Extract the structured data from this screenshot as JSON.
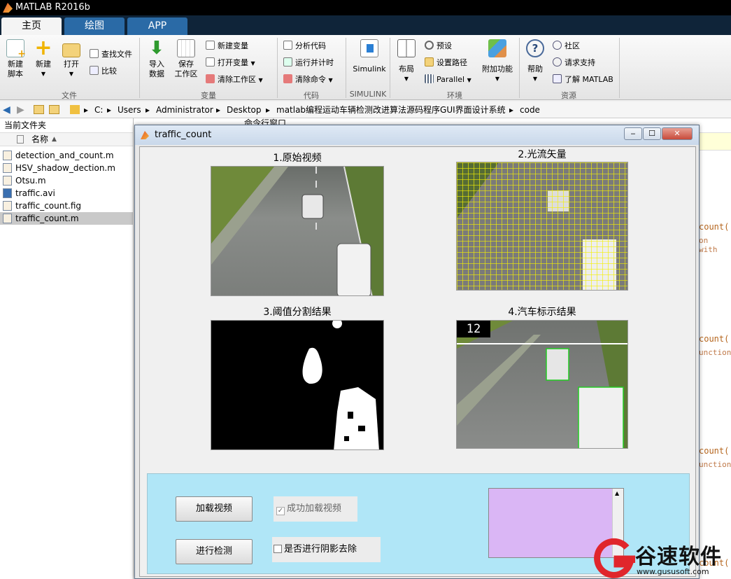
{
  "app": {
    "title": "MATLAB R2016b"
  },
  "tabs": [
    {
      "label": "主页"
    },
    {
      "label": "绘图"
    },
    {
      "label": "APP"
    }
  ],
  "ribbon": {
    "file": {
      "new_script": "新建\n脚本",
      "new": "新建",
      "open": "打开",
      "find_files": "查找文件",
      "compare": "比较",
      "group": "文件"
    },
    "variable": {
      "import": "导入\n数据",
      "save": "保存\n工作区",
      "new_var": "新建变量",
      "open_var": "打开变量",
      "clear_ws": "清除工作区",
      "group": "变量"
    },
    "code": {
      "analyze": "分析代码",
      "run_time": "运行并计时",
      "clear_cmd": "清除命令",
      "group": "代码"
    },
    "simulink": {
      "label": "Simulink",
      "group": "SIMULINK"
    },
    "env": {
      "layout": "布局",
      "prefs": "预设",
      "set_path": "设置路径",
      "parallel": "Parallel",
      "addons": "附加功能",
      "group": "环境"
    },
    "resources": {
      "help": "帮助",
      "community": "社区",
      "support": "请求支持",
      "learn": "了解 MATLAB",
      "group": "资源"
    }
  },
  "breadcrumb": [
    "C:",
    "Users",
    "Administrator",
    "Desktop",
    "matlab编程运动车辆检测改进算法源码程序GUI界面设计系统",
    "code"
  ],
  "file_browser": {
    "title": "当前文件夹",
    "column": "名称",
    "files": [
      "detection_and_count.m",
      "HSV_shadow_dection.m",
      "Otsu.m",
      "traffic.avi",
      "traffic_count.fig",
      "traffic_count.m"
    ],
    "selected": 5
  },
  "command_window": {
    "title": "命令行窗口",
    "snippets": [
      "count(",
      "on with",
      "count(",
      "unction",
      "count(",
      "unction",
      "count("
    ]
  },
  "figure": {
    "title": "traffic_count",
    "labels": [
      "1.原始视频",
      "2.光流矢量",
      "3.阈值分割结果",
      "4.汽车标示结果"
    ],
    "count_display": "12",
    "load_button": "加载视频",
    "detect_button": "进行检测",
    "load_status": "成功加载视频",
    "shadow_option": "是否进行阴影去除"
  },
  "watermark": {
    "text": "谷速软件",
    "url": "www.gususoft.com"
  }
}
